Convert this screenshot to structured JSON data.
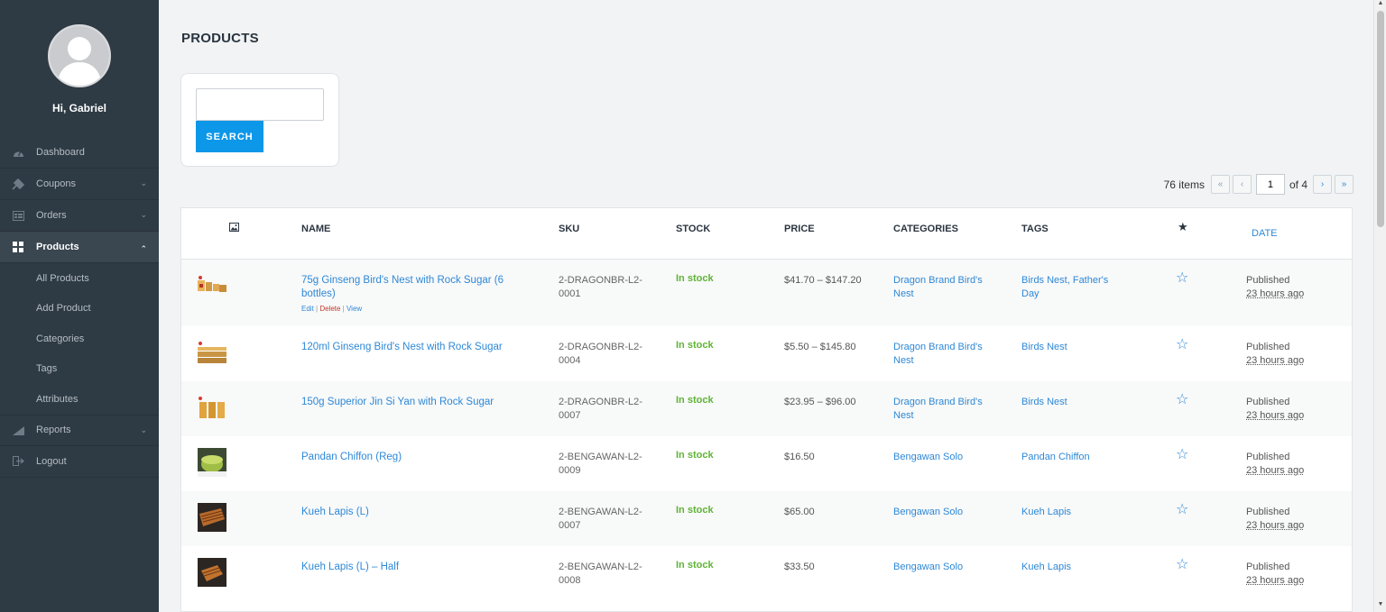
{
  "sidebar": {
    "greeting": "Hi, Gabriel",
    "items": [
      {
        "label": "Dashboard",
        "icon": "dashboard-icon"
      },
      {
        "label": "Coupons",
        "icon": "coupons-icon",
        "chevron": "down"
      },
      {
        "label": "Orders",
        "icon": "orders-icon",
        "chevron": "down"
      },
      {
        "label": "Products",
        "icon": "products-icon",
        "chevron": "up",
        "active": true
      },
      {
        "label": "Reports",
        "icon": "reports-icon",
        "chevron": "down"
      },
      {
        "label": "Logout",
        "icon": "logout-icon"
      }
    ],
    "sub_items": [
      "All Products",
      "Add Product",
      "Categories",
      "Tags",
      "Attributes"
    ]
  },
  "main": {
    "title": "PRODUCTS",
    "search": {
      "value": "",
      "button_label": "SEARCH"
    },
    "pagination": {
      "count": "76 items",
      "first": "«",
      "prev": "‹",
      "current": "1",
      "of": "of 4",
      "next": "›",
      "last": "»"
    },
    "table": {
      "headers": {
        "image": "image-icon",
        "name": "NAME",
        "sku": "SKU",
        "stock": "STOCK",
        "price": "PRICE",
        "categories": "CATEGORIES",
        "tags": "TAGS",
        "featured": "★",
        "date": "DATE"
      },
      "row_actions": {
        "edit": "Edit",
        "sep": " | ",
        "delete": "Delete",
        "view": "View"
      },
      "rows": [
        {
          "name": "75g Ginseng Bird's Nest with Rock Sugar (6 bottles)",
          "sku": "2-DRAGONBR-L2-0001",
          "stock": "In stock",
          "price": "$41.70 – $147.20",
          "categories": "Dragon Brand Bird's Nest",
          "tags": "Birds Nest, Father's Day",
          "status": "Published",
          "ago": "23 hours ago"
        },
        {
          "name": "120ml Ginseng Bird's Nest with Rock Sugar",
          "sku": "2-DRAGONBR-L2-0004",
          "stock": "In stock",
          "price": "$5.50 – $145.80",
          "categories": "Dragon Brand Bird's Nest",
          "tags": "Birds Nest",
          "status": "Published",
          "ago": "23 hours ago"
        },
        {
          "name": "150g Superior Jin Si Yan with Rock Sugar",
          "sku": "2-DRAGONBR-L2-0007",
          "stock": "In stock",
          "price": "$23.95 – $96.00",
          "categories": "Dragon Brand Bird's Nest",
          "tags": "Birds Nest",
          "status": "Published",
          "ago": "23 hours ago"
        },
        {
          "name": "Pandan Chiffon (Reg)",
          "sku": "2-BENGAWAN-L2-0009",
          "stock": "In stock",
          "price": "$16.50",
          "categories": "Bengawan Solo",
          "tags": "Pandan Chiffon",
          "status": "Published",
          "ago": "23 hours ago"
        },
        {
          "name": "Kueh Lapis (L)",
          "sku": "2-BENGAWAN-L2-0007",
          "stock": "In stock",
          "price": "$65.00",
          "categories": "Bengawan Solo",
          "tags": "Kueh Lapis",
          "status": "Published",
          "ago": "23 hours ago"
        },
        {
          "name": "Kueh Lapis (L) – Half",
          "sku": "2-BENGAWAN-L2-0008",
          "stock": "In stock",
          "price": "$33.50",
          "categories": "Bengawan Solo",
          "tags": "Kueh Lapis",
          "status": "Published",
          "ago": "23 hours ago"
        }
      ]
    }
  },
  "colors": {
    "sidebar_bg": "#2e3a44",
    "accent": "#0d97e8",
    "link": "#2e88d6",
    "stock": "#5fb336",
    "delete": "#c0392b"
  }
}
